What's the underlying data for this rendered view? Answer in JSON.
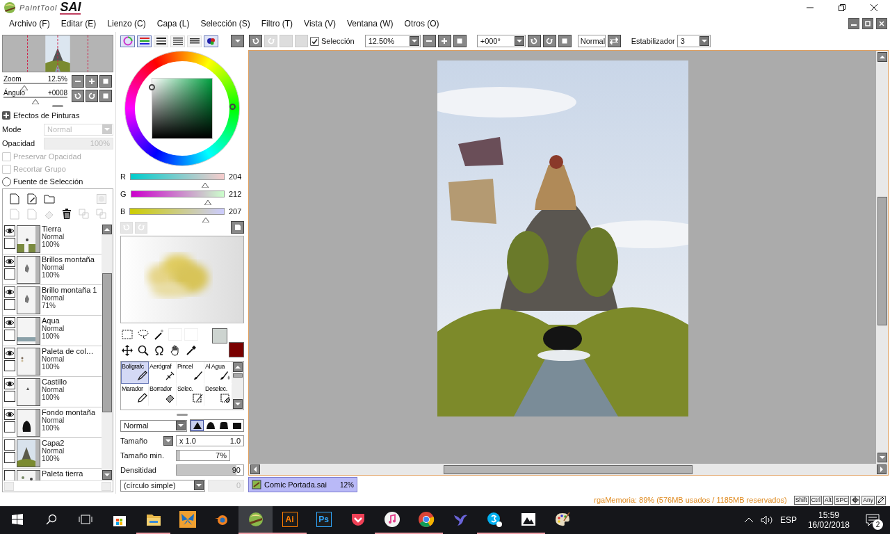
{
  "title_bar": {
    "logo_small": "PaintTool",
    "logo_big": "SAI"
  },
  "menu": [
    "Archivo (F)",
    "Editar (E)",
    "Lienzo (C)",
    "Capa (L)",
    "Selección (S)",
    "Filtro (T)",
    "Vista (V)",
    "Ventana (W)",
    "Otros (O)"
  ],
  "navigator": {
    "zoom": {
      "label": "Zoom",
      "value": "12.5%",
      "level": 0.33
    },
    "angle": {
      "label": "Ángulo",
      "value": "+0008",
      "level": 0.5
    }
  },
  "paint_effects": {
    "title": "Efectos de Pinturas",
    "expanded": false,
    "mode": {
      "label": "Mode",
      "value": "Normal",
      "disabled": true
    },
    "opacity": {
      "label": "Opacidad",
      "value": "100%",
      "disabled": true
    }
  },
  "layer_options": [
    {
      "kind": "checkbox",
      "label": "Preservar Opacidad",
      "checked": false,
      "disabled": true
    },
    {
      "kind": "checkbox",
      "label": "Recortar Grupo",
      "checked": false,
      "disabled": true
    },
    {
      "kind": "radio",
      "label": "Fuente de Selección",
      "checked": false,
      "disabled": false
    }
  ],
  "layers": [
    {
      "name": "Tierra",
      "mode": "Normal",
      "opacity": "100%",
      "visible": true,
      "checked": false
    },
    {
      "name": "Brillos montaña",
      "mode": "Normal",
      "opacity": "100%",
      "visible": true,
      "checked": false
    },
    {
      "name": "Brillo montaña 1",
      "mode": "Normal",
      "opacity": "71%",
      "visible": true,
      "checked": false
    },
    {
      "name": "Aqua",
      "mode": "Normal",
      "opacity": "100%",
      "visible": true,
      "checked": false
    },
    {
      "name": "Paleta de col…",
      "mode": "Normal",
      "opacity": "100%",
      "visible": true,
      "checked": false
    },
    {
      "name": "Castillo",
      "mode": "Normal",
      "opacity": "100%",
      "visible": true,
      "checked": false
    },
    {
      "name": "Fondo montaña",
      "mode": "Normal",
      "opacity": "100%",
      "visible": true,
      "checked": false
    },
    {
      "name": "Capa2",
      "mode": "Normal",
      "opacity": "100%",
      "visible": false,
      "checked": false
    },
    {
      "name": "Paleta tierra",
      "visible": false
    }
  ],
  "color_modes": [
    {
      "kind": "wheel",
      "selected": true
    },
    {
      "kind": "rgb",
      "selected": true
    },
    {
      "kind": "hsv",
      "selected": false
    },
    {
      "kind": "bars",
      "selected": false
    },
    {
      "kind": "grid",
      "selected": false
    },
    {
      "kind": "palette",
      "selected": true
    }
  ],
  "rgb": [
    {
      "label": "R",
      "value": "204",
      "level": 0.8
    },
    {
      "label": "G",
      "value": "212",
      "level": 0.83
    },
    {
      "label": "B",
      "value": "207",
      "level": 0.81
    }
  ],
  "swatches": [
    {
      "color": "#cdd4d0"
    },
    {
      "color": "#7a0000"
    }
  ],
  "tools": [
    {
      "kind": "pen",
      "label": "Bolígrafc",
      "selected": true
    },
    {
      "kind": "airbrush",
      "label": "Aerógraf",
      "selected": false
    },
    {
      "kind": "brush",
      "label": "Pincel",
      "selected": false
    },
    {
      "kind": "water",
      "label": "Al Agua",
      "selected": false
    },
    {
      "kind": "marker",
      "label": "Marador",
      "selected": false
    },
    {
      "kind": "eraser",
      "label": "Borrador",
      "selected": false
    },
    {
      "kind": "select",
      "label": "Selec.",
      "selected": false
    },
    {
      "kind": "deselect",
      "label": "Deselec.",
      "selected": false
    }
  ],
  "brush": {
    "blend": "Normal",
    "shapes": [
      {
        "kind": "sharp",
        "selected": true
      },
      {
        "kind": "round",
        "selected": false
      },
      {
        "kind": "flat",
        "selected": false
      },
      {
        "kind": "square",
        "selected": false
      }
    ],
    "size": {
      "label": "Tamaño",
      "multiplier": "x 1.0",
      "value": "1.0"
    },
    "min_size": {
      "label": "Tamaño min.",
      "value": "7%",
      "level": 0.07
    },
    "density": {
      "label": "Densitidad",
      "value": "90",
      "level": 0.9
    },
    "texture": {
      "value": "(círculo simple)",
      "strength": "0"
    }
  },
  "toolbar": {
    "selection": {
      "label": "Selección",
      "checked": true
    },
    "zoom": "12.50%",
    "angle": "+000°",
    "blend": "Normal",
    "stabilizer": {
      "label": "Estabilizador",
      "value": "3"
    }
  },
  "documents": [
    {
      "name": "Comic Portada.sai",
      "zoom": "12%",
      "selected": true
    }
  ],
  "status": {
    "memory": "rgaMemoria: 89% (576MB usados / 1185MB reservados)",
    "keys": [
      "Shift",
      "Ctrl",
      "Alt",
      "SPC"
    ],
    "any": "Any"
  },
  "taskbar": {
    "apps": [
      {
        "kind": "store",
        "running": false,
        "selected": false
      },
      {
        "kind": "folder",
        "running": true,
        "selected": false
      },
      {
        "kind": "butterfly",
        "running": false,
        "selected": false
      },
      {
        "kind": "blender",
        "running": false,
        "selected": false
      },
      {
        "kind": "sai",
        "running": true,
        "selected": true
      },
      {
        "kind": "letters",
        "label": "Ai",
        "color": "#ff7c00",
        "running": true,
        "selected": false
      },
      {
        "kind": "letters",
        "label": "Ps",
        "color": "#31a8ff",
        "running": false,
        "selected": false
      },
      {
        "kind": "pocket",
        "running": false,
        "selected": false
      },
      {
        "kind": "music",
        "running": true,
        "selected": false
      },
      {
        "kind": "chrome",
        "running": true,
        "selected": false
      },
      {
        "kind": "bird",
        "running": false,
        "selected": false
      },
      {
        "kind": "skype",
        "running": true,
        "selected": false
      },
      {
        "kind": "photos",
        "running": true,
        "selected": false
      },
      {
        "kind": "palette",
        "running": false,
        "selected": false
      }
    ],
    "language": "ESP",
    "time": "15:59",
    "date": "16/02/2018",
    "notifications": "2"
  }
}
